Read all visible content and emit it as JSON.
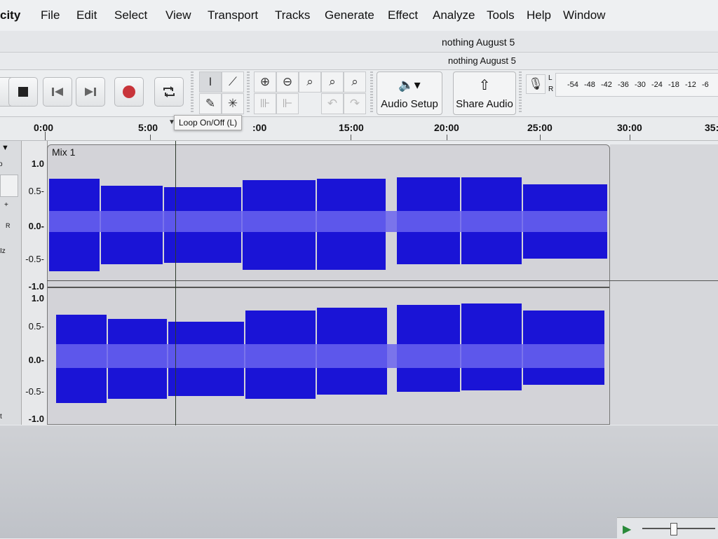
{
  "menu": [
    "city",
    "File",
    "Edit",
    "Select",
    "View",
    "Transport",
    "Tracks",
    "Generate",
    "Effect",
    "Analyze",
    "Tools",
    "Help",
    "Window"
  ],
  "window_title": "nothing August 5",
  "project_title": "nothing August 5",
  "toolbar": {
    "audio_setup_label": "Audio Setup",
    "share_audio_label": "Share Audio",
    "meter_channels": [
      "L",
      "R"
    ],
    "meter_scale": [
      "-54",
      "-48",
      "-42",
      "-36",
      "-30",
      "-24",
      "-18",
      "-12",
      "-6"
    ]
  },
  "tooltip": "Loop On/Off (L)",
  "timeline": {
    "labels": [
      "0:00",
      "5:00",
      "10:00",
      "15:00",
      "20:00",
      "25:00",
      "30:00",
      "35:"
    ],
    "visible_labels": [
      "0:00",
      "5:00",
      ":00",
      "15:00",
      "20:00",
      "25:00",
      "30:00",
      "35:"
    ]
  },
  "track": {
    "clip_name": "Mix 1",
    "ruler_top": [
      "1.0",
      "0.5-",
      "0.0-",
      "-0.5-",
      "-1.0"
    ],
    "ruler_bottom": [
      "1.0",
      "0.5-",
      "0.0-",
      "-0.5-",
      "-1.0"
    ],
    "panel_letters": [
      "o",
      "+",
      "R",
      "Iz",
      "t"
    ]
  },
  "colors": {
    "waveform": "#1a14d6",
    "waveform_rms": "#6a63ee",
    "clip_bg": "#d3d3d8",
    "record_red": "#c8343a"
  }
}
